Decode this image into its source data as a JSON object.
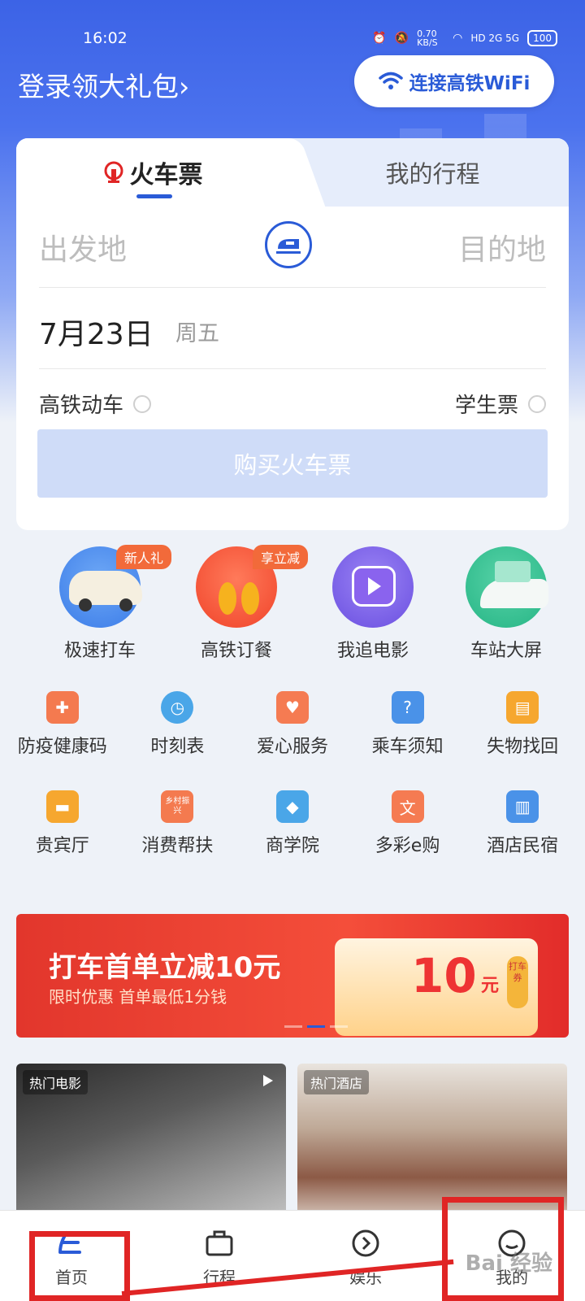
{
  "status_bar": {
    "time": "16:02",
    "speed": "0.70 KB/S",
    "network": "HD 2G 5G",
    "battery": "100"
  },
  "header": {
    "gift_label": "登录领大礼包",
    "gift_chevron": "›",
    "wifi_label": "连接高铁WiFi"
  },
  "booking": {
    "tab_train": "火车票",
    "tab_trips": "我的行程",
    "from_placeholder": "出发地",
    "to_placeholder": "目的地",
    "date": "7月23日",
    "weekday": "周五",
    "option_highspeed": "高铁动车",
    "option_student": "学生票",
    "buy_label": "购买火车票"
  },
  "featured": [
    {
      "label": "极速打车",
      "badge": "新人礼",
      "icon": "car-icon"
    },
    {
      "label": "高铁订餐",
      "badge": "享立减",
      "icon": "meal-icon"
    },
    {
      "label": "我追电影",
      "badge": "",
      "icon": "tv-icon"
    },
    {
      "label": "车站大屏",
      "badge": "",
      "icon": "train-screen-icon"
    }
  ],
  "services_row1": [
    {
      "label": "防疫健康码",
      "icon": "health-code-icon",
      "color": "#f47a4f"
    },
    {
      "label": "时刻表",
      "icon": "schedule-icon",
      "color": "#4aa6e8"
    },
    {
      "label": "爱心服务",
      "icon": "heart-hand-icon",
      "color": "#f57b52"
    },
    {
      "label": "乘车须知",
      "icon": "notice-icon",
      "color": "#4a92e8"
    },
    {
      "label": "失物找回",
      "icon": "luggage-icon",
      "color": "#f6a72f"
    }
  ],
  "services_row2": [
    {
      "label": "贵宾厅",
      "icon": "sofa-icon",
      "color": "#f6a72f"
    },
    {
      "label": "消费帮扶",
      "icon": "rural-icon",
      "color": "#f47a4f",
      "text": "乡村振兴"
    },
    {
      "label": "商学院",
      "icon": "graduation-cap-icon",
      "color": "#4aa6e8"
    },
    {
      "label": "多彩e购",
      "icon": "shopping-bag-icon",
      "color": "#f57b52"
    },
    {
      "label": "酒店民宿",
      "icon": "hotel-building-icon",
      "color": "#4a92e8"
    }
  ],
  "banner": {
    "title": "打车首单立减10元",
    "subtitle": "限时优惠 首单最低1分钱",
    "amount": "10",
    "unit": "元",
    "tag": "打车券"
  },
  "feed": {
    "movies_label": "热门电影",
    "hotels_label": "热门酒店"
  },
  "bottom_nav": [
    {
      "label": "首页",
      "icon": "home-icon"
    },
    {
      "label": "行程",
      "icon": "trip-icon"
    },
    {
      "label": "娱乐",
      "icon": "play-circle-icon"
    },
    {
      "label": "我的",
      "icon": "profile-icon"
    }
  ],
  "watermark": "Bai 经验",
  "colors": {
    "brand": "#2a5bd7",
    "annotation": "#e02525"
  }
}
